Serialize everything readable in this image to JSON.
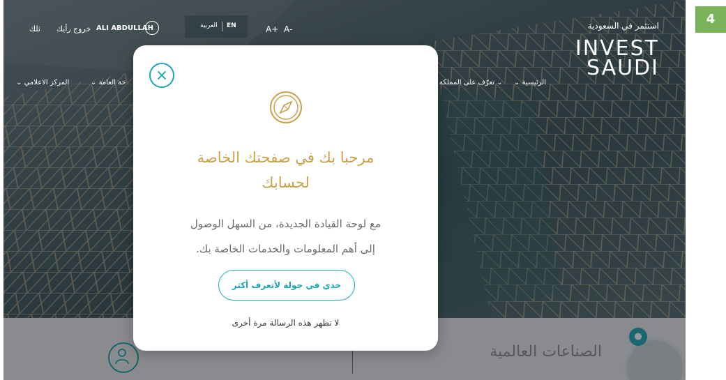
{
  "step_badge": "4",
  "topnav": {
    "your_opinion": "رأيك",
    "logout": "خروج",
    "user_name": "ALI ABDULLAH",
    "lang_en": "EN",
    "lang_ar": "العربية",
    "font_plus": "A+",
    "font_minus": "A-"
  },
  "logo": {
    "tagline": "استثمر في السعودية",
    "invest": "INVEST",
    "saudi": "SAUDI"
  },
  "mainnav": {
    "home": "الرئيسية",
    "know_kingdom": "تعرّف على المملكة",
    "general": "حة العامة",
    "media_center": "المركز الاعلامي"
  },
  "modal": {
    "title_line1": "مرحبا بك في صفحتك الخاصة",
    "title_line2": "لحسابك",
    "body_line1": "مع لوحة القيادة الجديدة، من السهل الوصول",
    "body_line2": "إلى أهم المعلومات والخدمات الخاصة بك.",
    "tour_button": "خذي في جولة لأتعرف أكثر",
    "dont_show": "لا تظهر هذه الرسالة مرة أخرى"
  },
  "bottom": {
    "industries": "الصناعات العالمية"
  },
  "colors": {
    "accent": "#1aa7b3",
    "gold": "#c9a24a",
    "badge": "#7bb35a"
  }
}
